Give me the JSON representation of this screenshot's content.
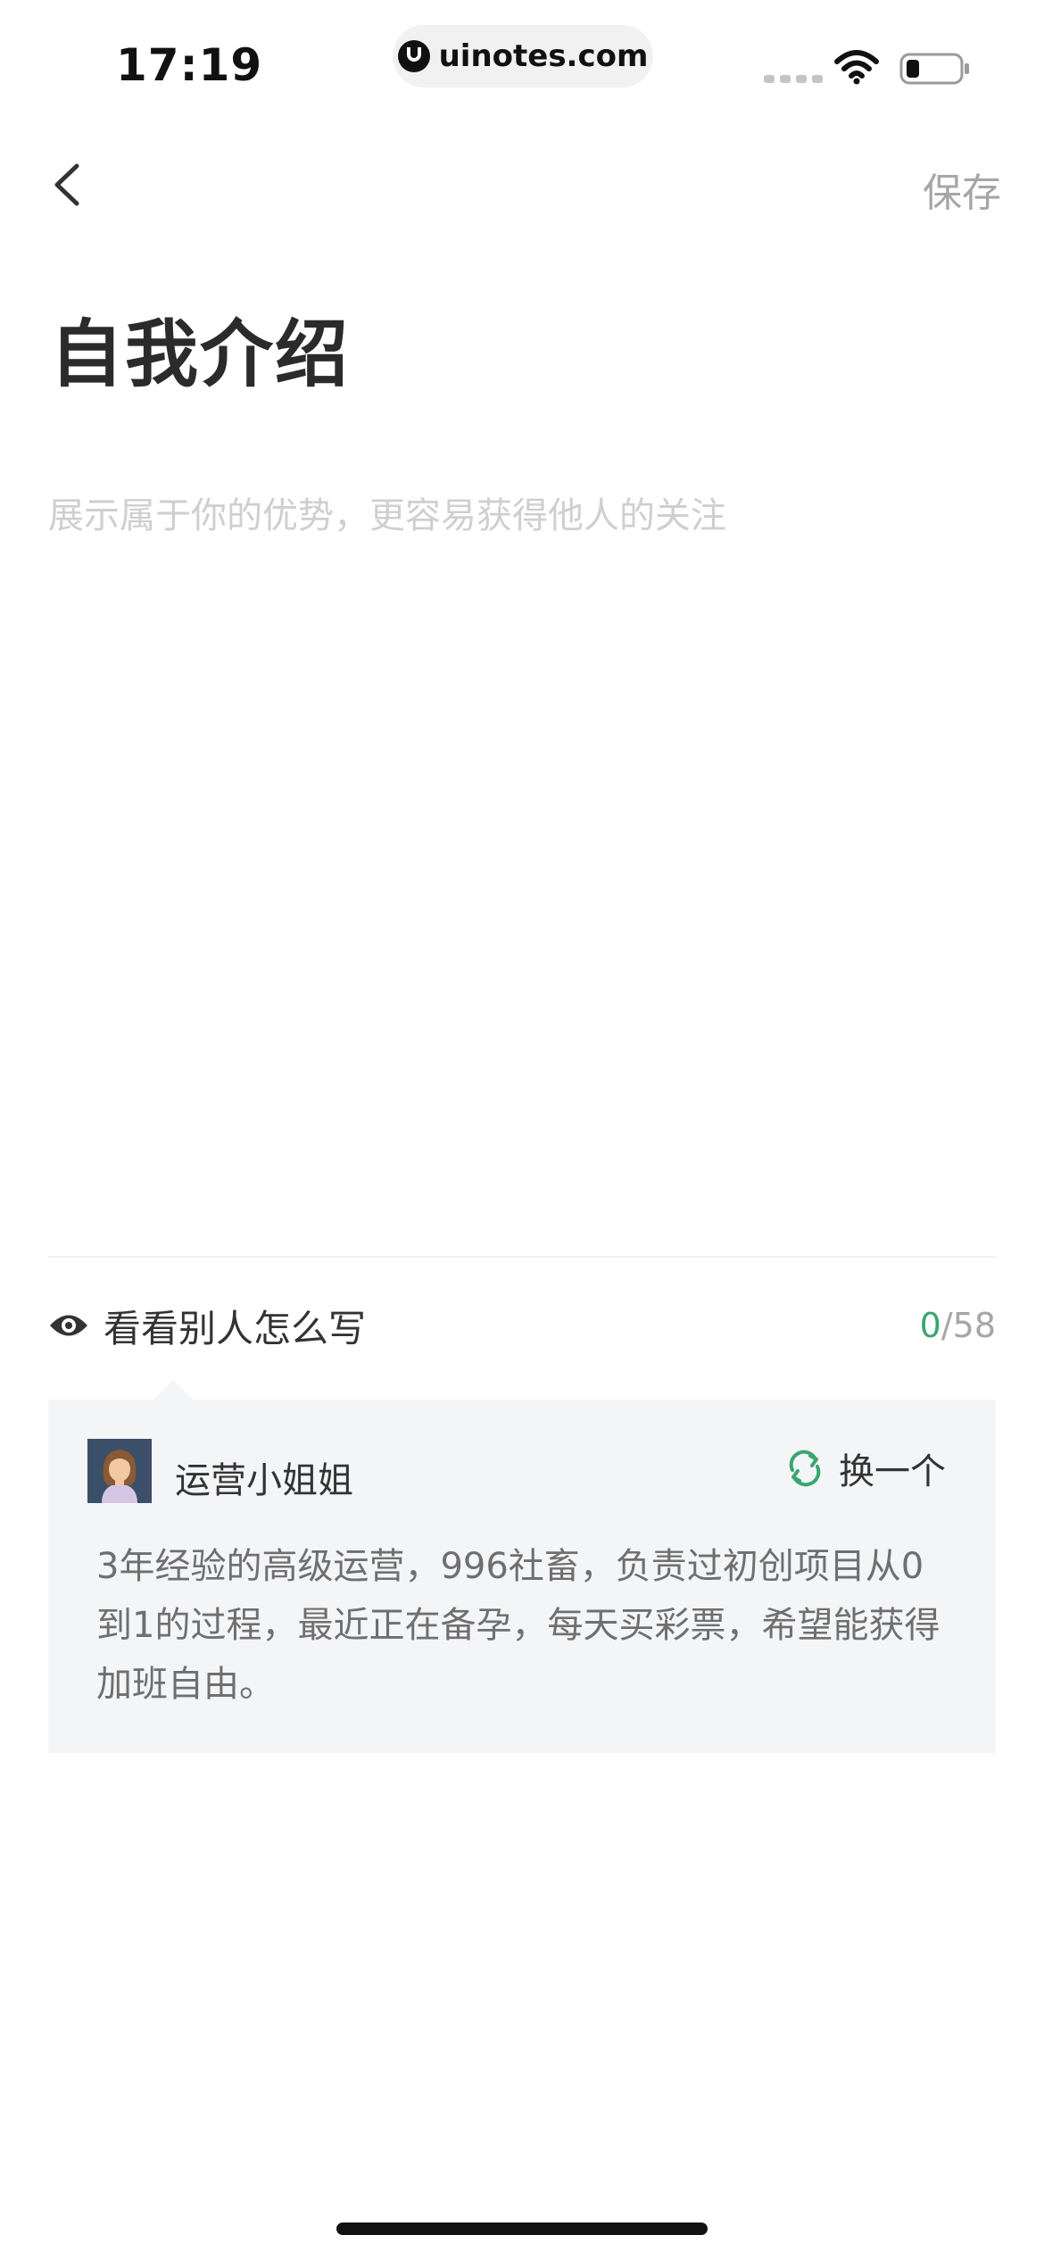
{
  "status_bar": {
    "time": "17:19",
    "url": "uinotes.com"
  },
  "nav": {
    "save_label": "保存"
  },
  "page": {
    "title": "自我介绍"
  },
  "intro_input": {
    "value": "",
    "placeholder": "展示属于你的优势，更容易获得他人的关注"
  },
  "examples": {
    "title": "看看别人怎么写",
    "count_current": "0",
    "count_max": "/58",
    "card": {
      "author": "运营小姐姐",
      "refresh_label": "换一个",
      "text": "3年经验的高级运营，996社畜，负责过初创项目从0到1的过程，最近正在备孕，每天买彩票，希望能获得加班自由。"
    }
  },
  "colors": {
    "accent": "#3aa56f",
    "muted": "#a6a6a6",
    "card_bg": "#f4f5f7"
  },
  "icons": [
    "back-arrow-icon",
    "eye-icon",
    "refresh-icon",
    "wifi-icon",
    "battery-icon",
    "uinotes-logo-icon"
  ]
}
